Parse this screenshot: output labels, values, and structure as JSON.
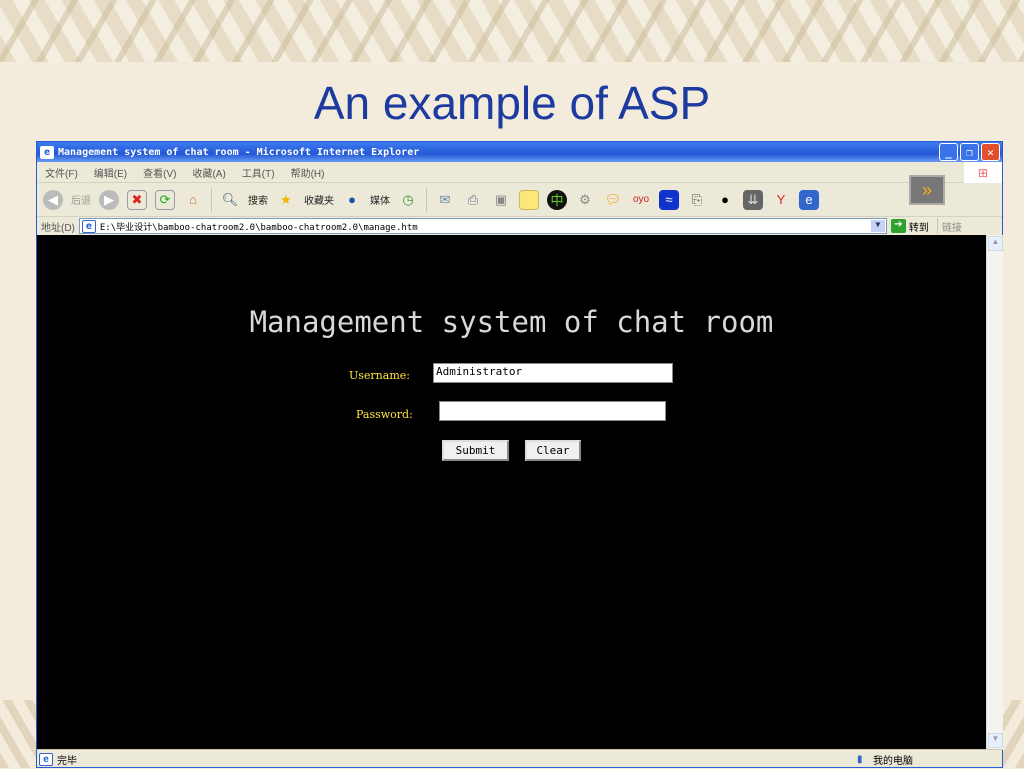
{
  "slide": {
    "title": "An example of ASP"
  },
  "window": {
    "title": "Management system of chat room - Microsoft Internet Explorer",
    "minimize": "_",
    "restore": "❐",
    "close": "✕"
  },
  "menu": [
    "文件(F)",
    "编辑(E)",
    "查看(V)",
    "收藏(A)",
    "工具(T)",
    "帮助(H)"
  ],
  "toolbar": {
    "back": "后退",
    "search": "搜索",
    "favorites": "收藏夹",
    "media": "媒体"
  },
  "address": {
    "label": "地址(D)",
    "url": "E:\\毕业设计\\bamboo-chatroom2.0\\bamboo-chatroom2.0\\manage.htm",
    "go": "转到",
    "links": "链接"
  },
  "page": {
    "heading": "Management system of chat room",
    "username_label": "Username:",
    "username_value": "Administrator",
    "password_label": "Password:",
    "password_value": "",
    "submit": "Submit",
    "clear": "Clear"
  },
  "status": {
    "text": "完毕",
    "zone": "我的电脑"
  }
}
